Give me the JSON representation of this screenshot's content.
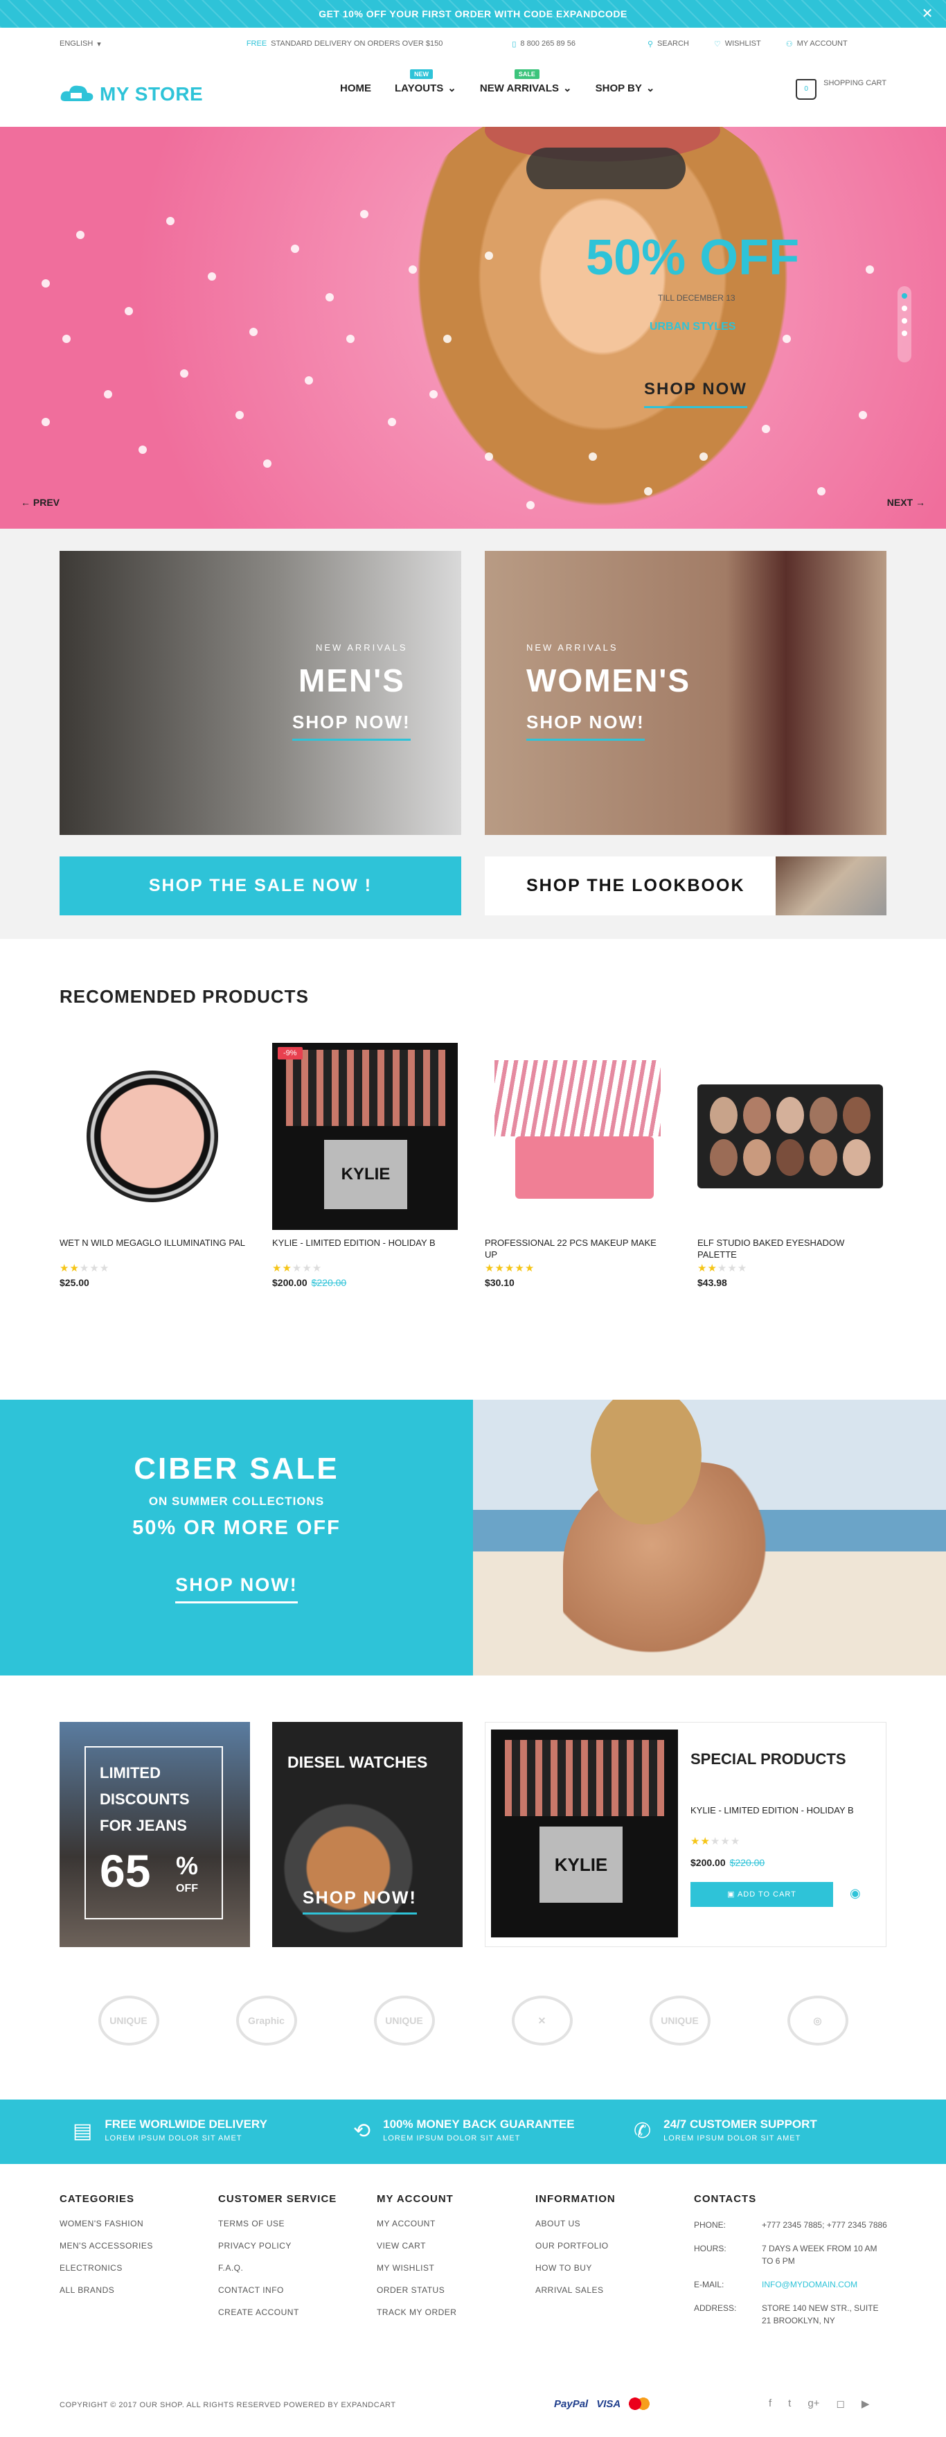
{
  "promo": {
    "text": "GET 10% OFF YOUR FIRST ORDER WITH CODE EXPANDCODE",
    "close": "✕"
  },
  "util": {
    "language": "ENGLISH",
    "free": "FREE",
    "delivery": "STANDARD DELIVERY ON ORDERS OVER $150",
    "phone": "8 800 265 89 56",
    "search": "SEARCH",
    "wishlist": "WISHLIST",
    "account": "MY ACCOUNT"
  },
  "header": {
    "logo": "MY STORE",
    "nav": [
      "HOME",
      "LAYOUTS",
      "NEW ARRIVALS",
      "SHOP BY"
    ],
    "badges": {
      "new": "NEW",
      "sale": "SALE"
    },
    "cart_label": "SHOPPING CART",
    "cart_count": "0"
  },
  "hero": {
    "headline": "50% OFF",
    "till": "TILL DECEMBER 13",
    "styles": "URBAN STYLES",
    "cta": "SHOP NOW",
    "prev": "PREV",
    "next": "NEXT"
  },
  "banners": {
    "men_label": "NEW ARRIVALS",
    "men_title": "MEN'S",
    "men_cta": "SHOP NOW!",
    "women_label": "NEW ARRIVALS",
    "women_title": "WOMEN'S",
    "women_cta": "SHOP NOW!",
    "sale_strip": "SHOP THE SALE NOW !",
    "lookbook": "SHOP THE LOOKBOOK"
  },
  "recommended": {
    "title": "RECOMENDED PRODUCTS",
    "products": [
      {
        "name": "WET N WILD MEGAGLO ILLUMINATING PAL",
        "price": "$25.00",
        "old": "",
        "rating": 2,
        "discount": ""
      },
      {
        "name": "KYLIE - LIMITED EDITION - HOLIDAY B",
        "price": "$200.00",
        "old": "$220.00",
        "rating": 2,
        "discount": "-9%"
      },
      {
        "name": "PROFESSIONAL 22 PCS MAKEUP MAKE UP",
        "price": "$30.10",
        "old": "",
        "rating": 5,
        "discount": ""
      },
      {
        "name": "ELF STUDIO BAKED EYESHADOW PALETTE",
        "price": "$43.98",
        "old": "",
        "rating": 2,
        "discount": ""
      }
    ]
  },
  "cyber": {
    "title": "CIBER SALE",
    "sub": "ON SUMMER COLLECTIONS",
    "offer": "50% OR MORE OFF",
    "cta": "SHOP NOW!"
  },
  "tiles": {
    "jeans1": "LIMITED",
    "jeans2": "DISCOUNTS",
    "jeans3": "FOR JEANS",
    "pct": "65",
    "pct_sign": "%",
    "off": "OFF",
    "watches": "DIESEL WATCHES",
    "watches_cta": "SHOP NOW!"
  },
  "special": {
    "title": "SPECIAL PRODUCTS",
    "name": "KYLIE - LIMITED EDITION - HOLIDAY B",
    "price": "$200.00",
    "old": "$220.00",
    "add": "ADD TO CART",
    "rating": 2
  },
  "brands": [
    "UNIQUE",
    "Graphic",
    "UNIQUE",
    "✕",
    "UNIQUE",
    "◎"
  ],
  "features": [
    {
      "title": "FREE WORLWIDE DELIVERY",
      "sub": "LOREM IPSUM DOLOR SIT AMET"
    },
    {
      "title": "100% MONEY BACK GUARANTEE",
      "sub": "LOREM IPSUM DOLOR SIT AMET"
    },
    {
      "title": "24/7 CUSTOMER SUPPORT",
      "sub": "LOREM IPSUM DOLOR SIT AMET"
    }
  ],
  "footer": {
    "cols": [
      {
        "title": "CATEGORIES",
        "links": [
          "WOMEN'S FASHION",
          "MEN'S ACCESSORIES",
          "ELECTRONICS",
          "ALL BRANDS"
        ]
      },
      {
        "title": "CUSTOMER SERVICE",
        "links": [
          "TERMS OF USE",
          "PRIVACY POLICY",
          "F.A.Q.",
          "CONTACT INFO",
          "CREATE ACCOUNT"
        ]
      },
      {
        "title": "MY ACCOUNT",
        "links": [
          "MY ACCOUNT",
          "VIEW CART",
          "MY WISHLIST",
          "ORDER STATUS",
          "TRACK MY ORDER"
        ]
      },
      {
        "title": "INFORMATION",
        "links": [
          "ABOUT US",
          "OUR PORTFOLIO",
          "HOW TO BUY",
          "ARRIVAL SALES"
        ]
      }
    ],
    "contacts_title": "CONTACTS",
    "contacts": [
      {
        "k": "PHONE:",
        "v": "+777 2345 7885; +777 2345 7886"
      },
      {
        "k": "HOURS:",
        "v": "7 DAYS A WEEK FROM 10 AM TO 6 PM"
      },
      {
        "k": "E-MAIL:",
        "v": "INFO@MYDOMAIN.COM"
      },
      {
        "k": "ADDRESS:",
        "v": "STORE 140 NEW STR., SUITE 21 BROOKLYN, NY"
      }
    ],
    "copyright": "COPYRIGHT © 2017 OUR SHOP. ALL RIGHTS RESERVED POWERED BY EXPANDCART",
    "payments": [
      "PayPal",
      "VISA"
    ],
    "social": [
      "f",
      "t",
      "g+",
      "◻",
      "▶"
    ]
  },
  "colors": {
    "accent": "#2ec3d8",
    "sale": "#e8404f",
    "star": "#f5c518"
  }
}
